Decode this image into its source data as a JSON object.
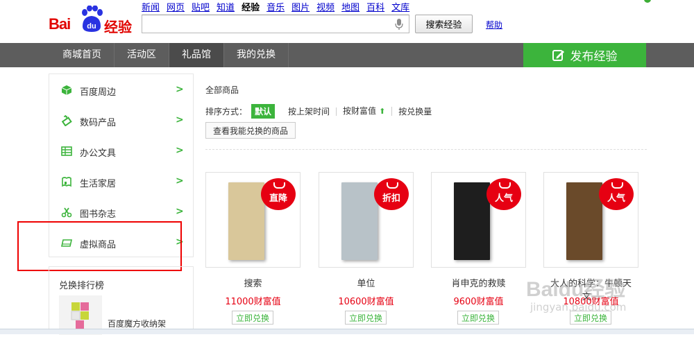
{
  "header": {
    "logo_text": "Bai",
    "logo_du": "du",
    "logo_jingyan": "经验",
    "nav_links": [
      {
        "label": "新闻",
        "active": false
      },
      {
        "label": "网页",
        "active": false
      },
      {
        "label": "贴吧",
        "active": false
      },
      {
        "label": "知道",
        "active": false
      },
      {
        "label": "经验",
        "active": true
      },
      {
        "label": "音乐",
        "active": false
      },
      {
        "label": "图片",
        "active": false
      },
      {
        "label": "视频",
        "active": false
      },
      {
        "label": "地图",
        "active": false
      },
      {
        "label": "百科",
        "active": false
      },
      {
        "label": "文库",
        "active": false
      }
    ],
    "search_value": "",
    "search_button": "搜索经验",
    "help": "帮助"
  },
  "menubar": {
    "items": [
      {
        "label": "商城首页",
        "active": false
      },
      {
        "label": "活动区",
        "active": false
      },
      {
        "label": "礼品馆",
        "active": true
      },
      {
        "label": "我的兑换",
        "active": false
      }
    ],
    "publish": "发布经验"
  },
  "sidebar": {
    "categories": [
      {
        "label": "百度周边",
        "icon": "box-icon"
      },
      {
        "label": "数码产品",
        "icon": "device-icon"
      },
      {
        "label": "办公文具",
        "icon": "table-icon"
      },
      {
        "label": "生活家居",
        "icon": "home-icon"
      },
      {
        "label": "图书杂志",
        "icon": "scissors-icon"
      },
      {
        "label": "虚拟商品",
        "icon": "card-icon"
      }
    ],
    "arrow": ">",
    "ranking_title": "兑换排行榜",
    "ranking_item": "百度魔方收纳架"
  },
  "filter": {
    "all_label": "全部商品",
    "sort_label": "排序方式：",
    "sort_default": "默认",
    "sort_options": [
      "按上架时间",
      "按财富值",
      "按兑换量"
    ],
    "my_exchangeable": "查看我能兑换的商品"
  },
  "products": [
    {
      "name": "搜索",
      "price": "11000财富值",
      "tag": "直降",
      "cover_color": "#d9c79a",
      "button": "立即兑换"
    },
    {
      "name": "单位",
      "price": "10600财富值",
      "tag": "折扣",
      "cover_color": "#b8c2c8",
      "button": "立即兑换"
    },
    {
      "name": "肖申克的救赎",
      "price": "9600财富值",
      "tag": "人气",
      "cover_color": "#1e1e1e",
      "button": "立即兑换"
    },
    {
      "name": "大人的科学：牛顿天文...",
      "price": "10800财富值",
      "tag": "人气",
      "cover_color": "#6a4a2a",
      "button": "立即兑换"
    }
  ],
  "watermark": {
    "line1": "Baidu经验",
    "line2": "jingyan.baidu.com"
  },
  "colors": {
    "brand_red": "#e10602",
    "green": "#3cb43c",
    "menubar": "#5d5d5d",
    "price_red": "#e60012",
    "highlight_box": "#e00000"
  }
}
